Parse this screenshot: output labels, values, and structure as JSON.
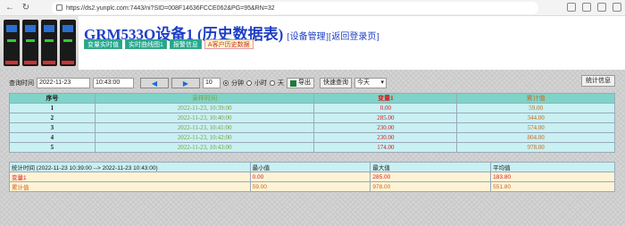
{
  "browser": {
    "url": "https://ds2.yunplc.com:7443/ni?SID=008F14636FCCE062&PG=95&RN=32"
  },
  "header": {
    "title": "GRM533Q设备1 (历史数据表)",
    "link_device": "[设备管理]",
    "link_login": "[返回登录页]",
    "tabs": [
      "变量实时值",
      "实时曲线图1",
      "报警信息",
      "A客户历史数据"
    ]
  },
  "toolbar": {
    "query_time_label": "查询时间",
    "date": "2022-11-23",
    "time": "10:43:00",
    "step": "10",
    "radio_minute": "分钟",
    "radio_hour": "小时",
    "radio_day": "天",
    "export_label": "导出",
    "quick_query_label": "快速查询",
    "quick_select": "今天",
    "stats_label": "统计信息"
  },
  "table": {
    "headers": [
      "序号",
      "采样时间",
      "变量1",
      "累计值"
    ],
    "rows": [
      [
        "1",
        "2022-11-23, 10:39:00",
        "0.00",
        "59.00"
      ],
      [
        "2",
        "2022-11-23, 10:40:00",
        "285.00",
        "344.00"
      ],
      [
        "3",
        "2022-11-23, 10:41:00",
        "230.00",
        "574.00"
      ],
      [
        "4",
        "2022-11-23, 10:42:00",
        "230.00",
        "804.00"
      ],
      [
        "5",
        "2022-11-23, 10:43:00",
        "174.00",
        "978.00"
      ]
    ]
  },
  "stats": {
    "header": [
      "统计时间 (2022-11-23 10:39:00 --> 2022-11-23 10:43:00)",
      "最小值",
      "最大值",
      "平均值"
    ],
    "rows": [
      [
        "变量1",
        "0.00",
        "285.00",
        "183.80"
      ],
      [
        "累计值",
        "59.00",
        "978.00",
        "551.80"
      ]
    ]
  },
  "colors": {
    "title": "#1e3fc6",
    "tab": "#1fa88e",
    "header_row": "#7fd3c8",
    "data_row": "#c9f0f2",
    "value": "#d02020",
    "cumulative": "#c96a1b",
    "time": "#7aa040"
  }
}
